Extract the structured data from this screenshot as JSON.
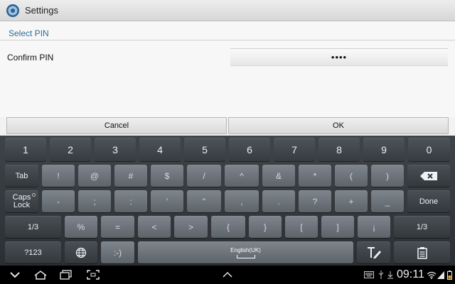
{
  "app": {
    "title": "Settings",
    "icon": "settings-gear-icon"
  },
  "section": {
    "title": "Select PIN"
  },
  "field": {
    "label": "Confirm PIN",
    "value": "••••"
  },
  "dialog": {
    "cancel_label": "Cancel",
    "ok_label": "OK"
  },
  "keyboard": {
    "row1": [
      "1",
      "2",
      "3",
      "4",
      "5",
      "6",
      "7",
      "8",
      "9",
      "0"
    ],
    "row2": [
      "!",
      "@",
      "#",
      "$",
      "/",
      "^",
      "&",
      "*",
      "(",
      ")"
    ],
    "row3": [
      "-",
      ";",
      ":",
      "'",
      "\"",
      ",",
      ".",
      "?",
      "+",
      "_"
    ],
    "row4": [
      "%",
      "=",
      "<",
      ">",
      "{",
      "}",
      "[",
      "]",
      "¡"
    ],
    "tab_label": "Tab",
    "caps_label": "Caps\nLock",
    "done_label": "Done",
    "page_left_label": "1/3",
    "page_right_label": "1/3",
    "mode_label": "?123",
    "emoticon_label": ":-)",
    "space_label": "English(UK)"
  },
  "statusbar": {
    "time": "09:11"
  },
  "colors": {
    "accent": "#2a6f97",
    "keyboard_bg": "#33383c",
    "navbar_bg": "#000000"
  }
}
